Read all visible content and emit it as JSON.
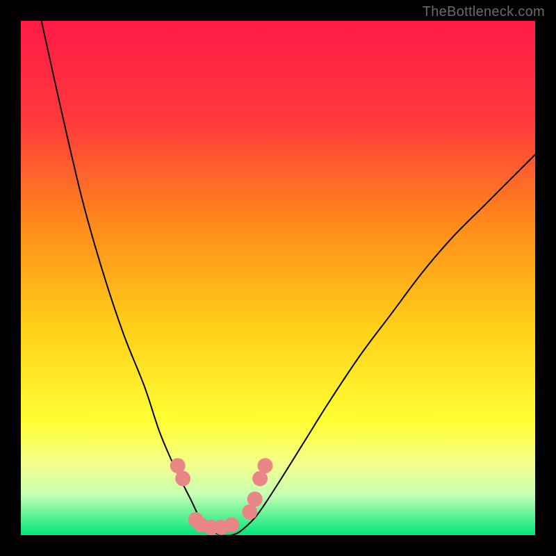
{
  "watermark": "TheBottleneck.com",
  "chart_data": {
    "type": "line",
    "title": "",
    "xlabel": "",
    "ylabel": "",
    "xlim": [
      0,
      100
    ],
    "ylim": [
      0,
      100
    ],
    "gradient_stops": [
      {
        "offset": 0,
        "color": "#ff1a47"
      },
      {
        "offset": 20,
        "color": "#ff3b3b"
      },
      {
        "offset": 40,
        "color": "#ff8c1a"
      },
      {
        "offset": 60,
        "color": "#ffd11a"
      },
      {
        "offset": 78,
        "color": "#ffff33"
      },
      {
        "offset": 86,
        "color": "#f5ff8a"
      },
      {
        "offset": 92,
        "color": "#c8ffb3"
      },
      {
        "offset": 100,
        "color": "#00e57a"
      }
    ],
    "series": [
      {
        "name": "bottleneck-curve",
        "type": "curve",
        "color": "#000000",
        "stroke_width": 2,
        "points": [
          {
            "x": 4,
            "y": 100
          },
          {
            "x": 8,
            "y": 82
          },
          {
            "x": 12,
            "y": 65
          },
          {
            "x": 16,
            "y": 51
          },
          {
            "x": 20,
            "y": 39
          },
          {
            "x": 24,
            "y": 29
          },
          {
            "x": 27,
            "y": 20
          },
          {
            "x": 30,
            "y": 13
          },
          {
            "x": 33,
            "y": 7
          },
          {
            "x": 35,
            "y": 3
          },
          {
            "x": 37,
            "y": 1
          },
          {
            "x": 39,
            "y": 0
          },
          {
            "x": 41,
            "y": 0
          },
          {
            "x": 43,
            "y": 1
          },
          {
            "x": 46,
            "y": 4
          },
          {
            "x": 50,
            "y": 10
          },
          {
            "x": 55,
            "y": 18
          },
          {
            "x": 60,
            "y": 26
          },
          {
            "x": 66,
            "y": 35
          },
          {
            "x": 72,
            "y": 43
          },
          {
            "x": 78,
            "y": 51
          },
          {
            "x": 84,
            "y": 58
          },
          {
            "x": 90,
            "y": 64
          },
          {
            "x": 96,
            "y": 70
          },
          {
            "x": 100,
            "y": 74
          }
        ]
      },
      {
        "name": "sample-dots",
        "type": "scatter",
        "color": "#e98787",
        "radius": 11,
        "points": [
          {
            "x": 30.5,
            "y": 13.5
          },
          {
            "x": 31.5,
            "y": 11
          },
          {
            "x": 34,
            "y": 3
          },
          {
            "x": 35,
            "y": 2
          },
          {
            "x": 37,
            "y": 1.5
          },
          {
            "x": 39,
            "y": 1.5
          },
          {
            "x": 41,
            "y": 2
          },
          {
            "x": 44.5,
            "y": 4.5
          },
          {
            "x": 45.5,
            "y": 7
          },
          {
            "x": 46.5,
            "y": 11
          },
          {
            "x": 47.5,
            "y": 13.5
          }
        ]
      }
    ]
  }
}
